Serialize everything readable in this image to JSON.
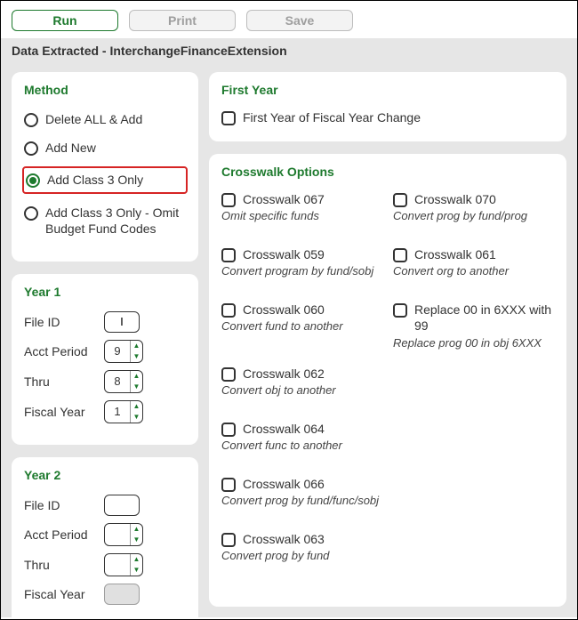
{
  "toolbar": {
    "run": "Run",
    "print": "Print",
    "save": "Save"
  },
  "title": "Data Extracted - InterchangeFinanceExtension",
  "method": {
    "header": "Method",
    "options": [
      {
        "label": "Delete ALL & Add",
        "checked": false,
        "highlight": false
      },
      {
        "label": "Add New",
        "checked": false,
        "highlight": false
      },
      {
        "label": "Add Class 3 Only",
        "checked": true,
        "highlight": true
      },
      {
        "label": "Add Class 3 Only - Omit Budget Fund Codes",
        "checked": false,
        "highlight": false
      }
    ]
  },
  "year1": {
    "header": "Year 1",
    "file_id_label": "File ID",
    "file_id_value": "I",
    "acct_period_label": "Acct Period",
    "acct_period_value": "9",
    "thru_label": "Thru",
    "thru_value": "8",
    "fiscal_year_label": "Fiscal Year",
    "fiscal_year_value": "1"
  },
  "year2": {
    "header": "Year 2",
    "file_id_label": "File ID",
    "file_id_value": "",
    "acct_period_label": "Acct Period",
    "acct_period_value": "",
    "thru_label": "Thru",
    "thru_value": "",
    "fiscal_year_label": "Fiscal Year",
    "fiscal_year_value": ""
  },
  "first_year": {
    "header": "First Year",
    "label": "First Year of Fiscal Year Change"
  },
  "crosswalk": {
    "header": "Crosswalk Options",
    "items": [
      {
        "label": "Crosswalk 067",
        "sub": "Omit specific funds"
      },
      {
        "label": "Crosswalk 070",
        "sub": "Convert prog by fund/prog"
      },
      {
        "label": "Crosswalk 059",
        "sub": "Convert program by fund/sobj"
      },
      {
        "label": "Crosswalk 061",
        "sub": "Convert org to another"
      },
      {
        "label": "Crosswalk 060",
        "sub": "Convert fund to another"
      },
      {
        "label": "Replace 00 in 6XXX with 99",
        "sub": "Replace prog 00 in obj 6XXX"
      },
      {
        "label": "Crosswalk 062",
        "sub": "Convert obj to another"
      },
      {
        "label": "",
        "sub": ""
      },
      {
        "label": "Crosswalk 064",
        "sub": "Convert func to another"
      },
      {
        "label": "",
        "sub": ""
      },
      {
        "label": "Crosswalk 066",
        "sub": "Convert prog by fund/func/sobj"
      },
      {
        "label": "",
        "sub": ""
      },
      {
        "label": "Crosswalk 063",
        "sub": "Convert prog by fund"
      },
      {
        "label": "",
        "sub": ""
      }
    ]
  }
}
